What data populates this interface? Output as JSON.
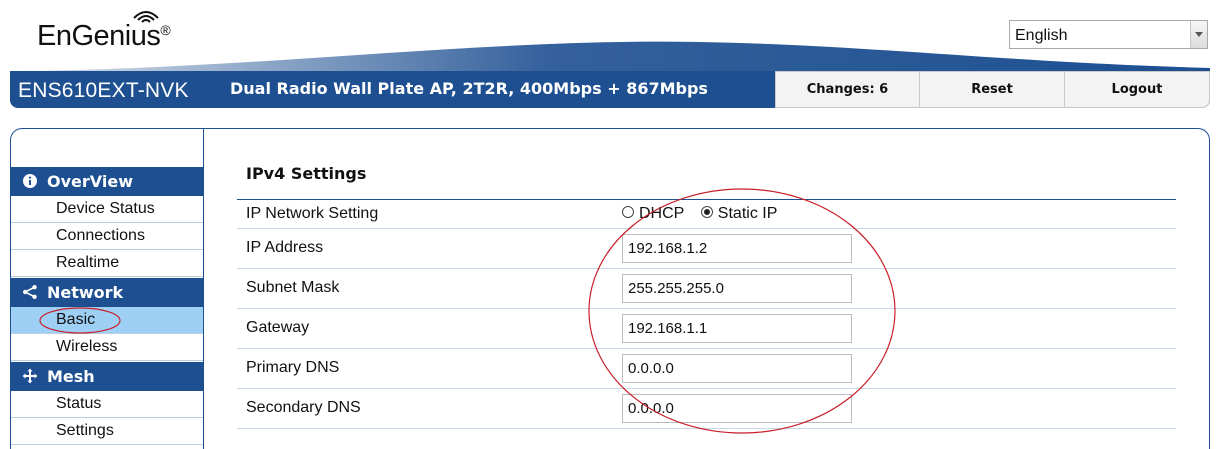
{
  "header": {
    "logo_text": "EnGenius",
    "logo_mark": "®",
    "language": {
      "selected": "English"
    },
    "model": "ENS610EXT-NVK",
    "description": "Dual Radio Wall Plate AP, 2T2R, 400Mbps + 867Mbps",
    "buttons": {
      "changes": "Changes: 6",
      "reset": "Reset",
      "logout": "Logout"
    }
  },
  "sidebar": {
    "sections": [
      {
        "label": "OverView",
        "icon": "info-icon",
        "items": [
          "Device Status",
          "Connections",
          "Realtime"
        ]
      },
      {
        "label": "Network",
        "icon": "share-icon",
        "items": [
          "Basic",
          "Wireless"
        ]
      },
      {
        "label": "Mesh",
        "icon": "move-arrows-icon",
        "items": [
          "Status",
          "Settings"
        ]
      }
    ],
    "active_item": "Basic"
  },
  "ipv4": {
    "title": "IPv4 Settings",
    "network_setting": {
      "label": "IP Network Setting",
      "options": [
        "DHCP",
        "Static IP"
      ],
      "selected": "Static IP"
    },
    "fields": [
      {
        "label": "IP Address",
        "value": "192.168.1.2"
      },
      {
        "label": "Subnet Mask",
        "value": "255.255.255.0"
      },
      {
        "label": "Gateway",
        "value": "192.168.1.1"
      },
      {
        "label": "Primary DNS",
        "value": "0.0.0.0"
      },
      {
        "label": "Secondary DNS",
        "value": "0.0.0.0"
      }
    ]
  },
  "colors": {
    "brand_blue": "#1d4f91",
    "active_item": "#9dd0f4",
    "annotation_red": "#c8202a"
  }
}
